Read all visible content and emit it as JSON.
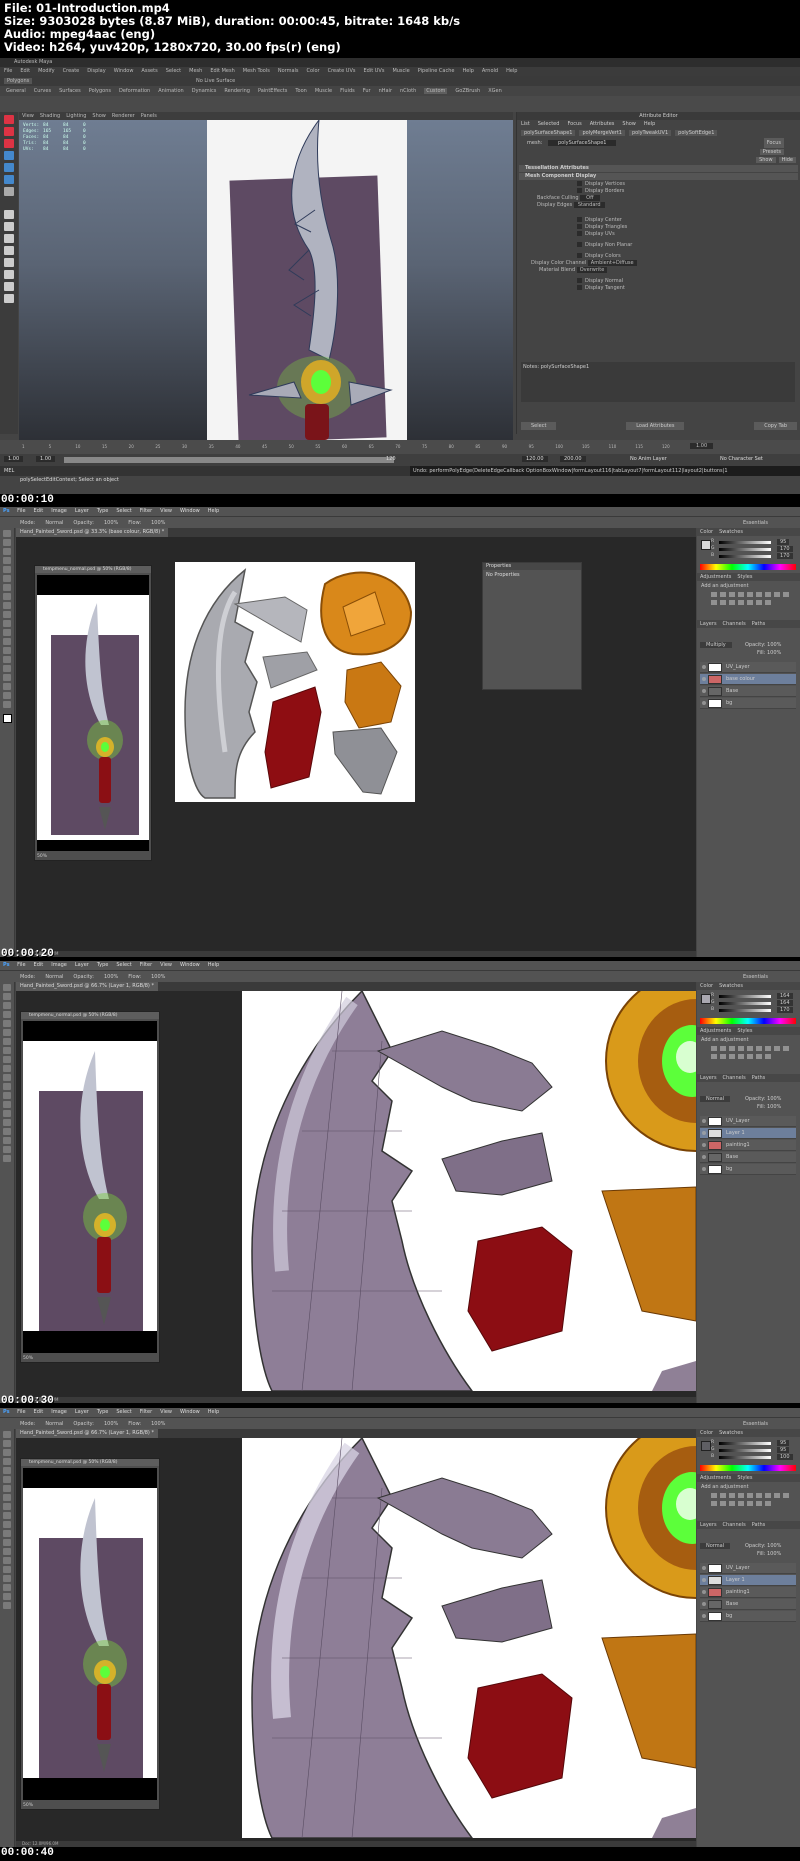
{
  "header": {
    "line1": "File: 01-Introduction.mp4",
    "line2": "Size: 9303028 bytes (8.87 MiB), duration: 00:00:45, bitrate: 1648 kb/s",
    "line3": "Audio: mpeg4aac (eng)",
    "line4": "Video: h264, yuv420p, 1280x720, 30.00 fps(r) (eng)"
  },
  "timestamps": [
    "00:00:10",
    "00:00:20",
    "00:00:30",
    "00:00:40"
  ],
  "maya": {
    "title": "Autodesk Maya",
    "menu": [
      "File",
      "Edit",
      "Modify",
      "Create",
      "Display",
      "Window",
      "Assets",
      "Select",
      "Mesh",
      "Edit Mesh",
      "Mesh Tools",
      "Normals",
      "Color",
      "Create UVs",
      "Edit UVs",
      "Muscle",
      "Pipeline Cache",
      "Help",
      "Arnold",
      "Help"
    ],
    "mode": "Polygons",
    "live_surface": "No Live Surface",
    "shelf_tabs": [
      "General",
      "Curves",
      "Surfaces",
      "Polygons",
      "Deformation",
      "Animation",
      "Dynamics",
      "Rendering",
      "PaintEffects",
      "Toon",
      "Muscle",
      "Fluids",
      "Fur",
      "nHair",
      "nCloth",
      "Custom",
      "GoZBrush",
      "XGen"
    ],
    "active_shelf_tab": "Custom",
    "viewport_menu": [
      "View",
      "Shading",
      "Lighting",
      "Show",
      "Renderer",
      "Panels"
    ],
    "hud": [
      {
        "label": "Verts:",
        "a": "84",
        "b": "84",
        "c": "0"
      },
      {
        "label": "Edges:",
        "a": "165",
        "b": "165",
        "c": "0"
      },
      {
        "label": "Faces:",
        "a": "84",
        "b": "84",
        "c": "0"
      },
      {
        "label": "Tris:",
        "a": "84",
        "b": "84",
        "c": "0"
      },
      {
        "label": "UVs:",
        "a": "84",
        "b": "84",
        "c": "0"
      }
    ],
    "attribute_editor": {
      "title": "Attribute Editor",
      "menu": [
        "List",
        "Selected",
        "Focus",
        "Attributes",
        "Show",
        "Help"
      ],
      "tabs": [
        "polySurfaceShape1",
        "polyMergeVert1",
        "polyTweakUV1",
        "polySoftEdge1"
      ],
      "mesh_label": "mesh:",
      "mesh_value": "polySurfaceShape1",
      "focus": "Focus",
      "presets": "Presets",
      "show": "Show",
      "hide": "Hide",
      "sections": [
        "Tessellation Attributes",
        "Mesh Component Display"
      ],
      "rows": [
        "Display Vertices",
        "Display Borders",
        "Backface Culling",
        "Display Edges",
        "Display Center",
        "Display Triangles",
        "Display UVs",
        "Display Non Planar",
        "Display Colors",
        "Display Color Channel",
        "Material Blend",
        "Display Normal",
        "Display Tangent"
      ],
      "culling_value": "Off",
      "edges_value": "Standard",
      "color_channel_value": "Ambient+Diffuse",
      "material_blend_value": "Overwrite",
      "notes": "Notes: polySurfaceShape1",
      "buttons": [
        "Select",
        "Load Attributes",
        "Copy Tab"
      ]
    },
    "timeline_ticks": [
      "1",
      "5",
      "10",
      "15",
      "20",
      "25",
      "30",
      "35",
      "40",
      "45",
      "50",
      "55",
      "60",
      "65",
      "70",
      "75",
      "80",
      "85",
      "90",
      "95",
      "100",
      "105",
      "110",
      "115",
      "120"
    ],
    "current_frame": "1.00",
    "range": {
      "start": "1.00",
      "end": "1.00",
      "mid": "120",
      "end2": "120.00",
      "end3": "200.00",
      "anim_layer": "No Anim Layer",
      "char_set": "No Character Set"
    },
    "cmd_label": "MEL",
    "cmd_feedback": "Undo: performPolyEdge(DeleteEdgeCallback OptionBoxWindow|formLayout116|tabLayout7|formLayout112|layout2|buttons|1",
    "help_line": "polySelectEditContext; Select an object"
  },
  "ps1": {
    "menu": [
      "File",
      "Edit",
      "Image",
      "Layer",
      "Type",
      "Select",
      "Filter",
      "View",
      "Window",
      "Help"
    ],
    "logo": "Ps",
    "opts": [
      "Mode:",
      "Normal",
      "Opacity:",
      "100%",
      "Flow:",
      "100%"
    ],
    "workspace": "Essentials",
    "tab": "Hand_Painted_Sword.psd @ 33.3% (base colour, RGB/8) *",
    "small_doc_title": "tempmenu_normal.psd @ 50% (RGB/8)",
    "small_doc_status": "50%",
    "props_title": "Properties",
    "props_body": "No Properties",
    "right_tabs": [
      "Color",
      "Swatches"
    ],
    "adj_tabs": [
      "Adjustments",
      "Styles"
    ],
    "adj_label": "Add an adjustment",
    "layers_tabs": [
      "Layers",
      "Channels",
      "Paths"
    ],
    "blend": "Multiply",
    "opacity": "Opacity: 100%",
    "fill": "Fill: 100%",
    "layers": [
      "UV_Layer",
      "base colour",
      "Base",
      "bg"
    ],
    "selected_layer": "base colour",
    "status": "Doc: 12.0M/91.3M",
    "rgb": [
      "R",
      "G",
      "B"
    ],
    "rgb_values": [
      "95",
      "170",
      "170"
    ]
  },
  "ps2": {
    "tab": "Hand_Painted_Sword.psd @ 66.7% (Layer 1, RGB/8) *",
    "workspace": "Essentials",
    "layers": [
      "UV_Layer",
      "Layer 1",
      "painting1",
      "Base",
      "bg"
    ],
    "selected_layer": "Layer 1",
    "blend": "Normal",
    "status": "Doc: 12.0M/96.0M",
    "small_doc_status": "50%",
    "rgb_values": [
      "164",
      "164",
      "170"
    ]
  },
  "ps3": {
    "tab": "Hand_Painted_Sword.psd @ 66.7% (Layer 1, RGB/8) *",
    "workspace": "Essentials",
    "layers": [
      "UV_Layer",
      "Layer 1",
      "painting1",
      "Base",
      "bg"
    ],
    "selected_layer": "Layer 1",
    "blend": "Normal",
    "status": "Doc: 12.0M/96.0M",
    "small_doc_status": "50%",
    "rgb_values": [
      "95",
      "95",
      "100"
    ]
  },
  "colors": {
    "ps_bg": "#464646",
    "ps_panel": "#535353",
    "canvas_dark": "#282828",
    "sword_plum": "#5e4a63",
    "blade_gray": "#b8b8c4",
    "gem_orange": "#d98a1a",
    "gem_green": "#5cff3a",
    "hilt_red": "#8b0f14",
    "selected_layer": "#6d7f9c"
  }
}
